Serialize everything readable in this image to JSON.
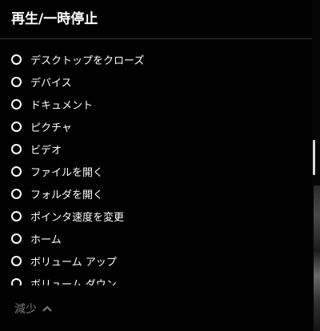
{
  "panel": {
    "title": "再生/一時停止",
    "items": [
      {
        "label": "デスクトップをクローズ"
      },
      {
        "label": "デバイス"
      },
      {
        "label": "ドキュメント"
      },
      {
        "label": "ピクチャ"
      },
      {
        "label": "ビデオ"
      },
      {
        "label": "ファイルを開く"
      },
      {
        "label": "フォルダを開く"
      },
      {
        "label": "ポインタ速度を変更"
      },
      {
        "label": "ホーム"
      },
      {
        "label": "ボリューム アップ"
      },
      {
        "label": "ボリューム ダウン"
      }
    ],
    "footer_label": "減少"
  },
  "icons": {
    "radio": "radio-button-icon",
    "chevron": "chevron-up-icon"
  }
}
